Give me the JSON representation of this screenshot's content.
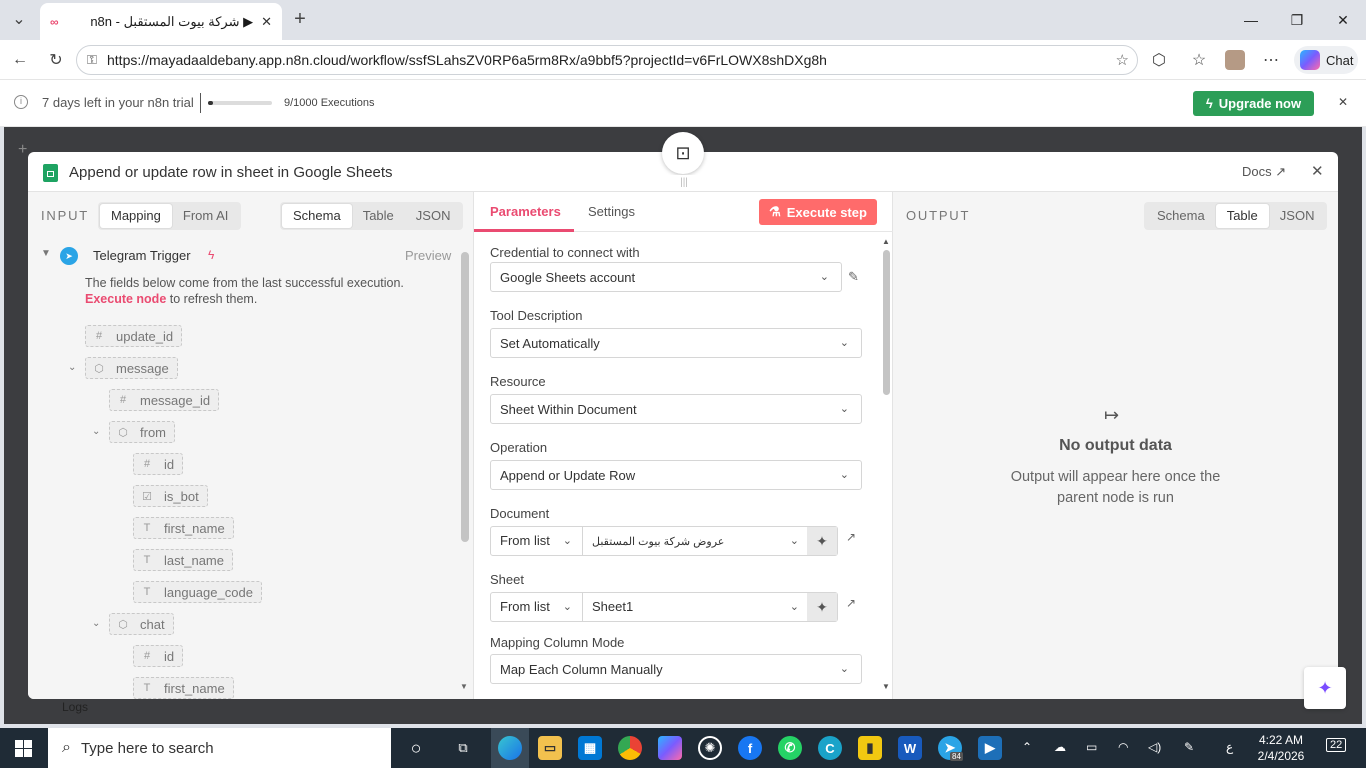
{
  "browser": {
    "tab_title": "n8n - شركة بيوت المستقبل ▶",
    "tab_favicon": "n8n",
    "url": "https://mayadaaldebany.app.n8n.cloud/workflow/ssfSLahsZV0RP6a5rm8Rx/a9bbf5?projectId=v6FrLOWX8shDXg8h",
    "chat_label": "Chat"
  },
  "trial": {
    "days_text": "7 days left in your n8n trial",
    "executions_text": "9/1000 Executions",
    "executions_fraction": 0.009,
    "upgrade_label": "Upgrade now"
  },
  "modal": {
    "title": "Append or update row in sheet in Google Sheets",
    "docs_label": "Docs"
  },
  "input": {
    "label": "INPUT",
    "mode_tabs": [
      "Mapping",
      "From AI"
    ],
    "view_tabs": [
      "Schema",
      "Table",
      "JSON"
    ],
    "trigger_name": "Telegram Trigger",
    "preview_label": "Preview",
    "note_text": "The fields below come from the last successful execution.",
    "note_link": "Execute node",
    "note_tail": " to refresh them.",
    "fields": [
      {
        "icon": "#",
        "name": "update_id"
      },
      {
        "icon": "⬡",
        "name": "message"
      },
      {
        "icon": "#",
        "name": "message_id"
      },
      {
        "icon": "⬡",
        "name": "from"
      },
      {
        "icon": "#",
        "name": "id"
      },
      {
        "icon": "☑",
        "name": "is_bot"
      },
      {
        "icon": "T",
        "name": "first_name"
      },
      {
        "icon": "T",
        "name": "last_name"
      },
      {
        "icon": "T",
        "name": "language_code"
      },
      {
        "icon": "⬡",
        "name": "chat"
      },
      {
        "icon": "#",
        "name": "id"
      },
      {
        "icon": "T",
        "name": "first_name"
      }
    ]
  },
  "params": {
    "tab_parameters": "Parameters",
    "tab_settings": "Settings",
    "execute_label": "Execute step",
    "credential_label": "Credential to connect with",
    "credential_value": "Google Sheets account",
    "tool_desc_label": "Tool Description",
    "tool_desc_value": "Set Automatically",
    "resource_label": "Resource",
    "resource_value": "Sheet Within Document",
    "operation_label": "Operation",
    "operation_value": "Append or Update Row",
    "document_label": "Document",
    "document_mode": "From list",
    "document_value": "عروض شركة بيوت المستقبل",
    "sheet_label": "Sheet",
    "sheet_mode": "From list",
    "sheet_value": "Sheet1",
    "mapping_label": "Mapping Column Mode",
    "mapping_value": "Map Each Column Manually"
  },
  "output": {
    "label": "OUTPUT",
    "view_tabs": [
      "Schema",
      "Table",
      "JSON"
    ],
    "empty_title": "No output data",
    "empty_sub": "Output will appear here once the parent node is run"
  },
  "canvas": {
    "logs_label": "Logs"
  },
  "taskbar": {
    "search_placeholder": "Type here to search",
    "time": "4:22 AM",
    "date": "2/4/2026",
    "lang": "ع",
    "notif_count": "22",
    "telegram_badge": "84"
  },
  "colors": {
    "accent": "#ea4b71",
    "upgrade": "#2c9e57",
    "execute": "#ff6b6b"
  }
}
